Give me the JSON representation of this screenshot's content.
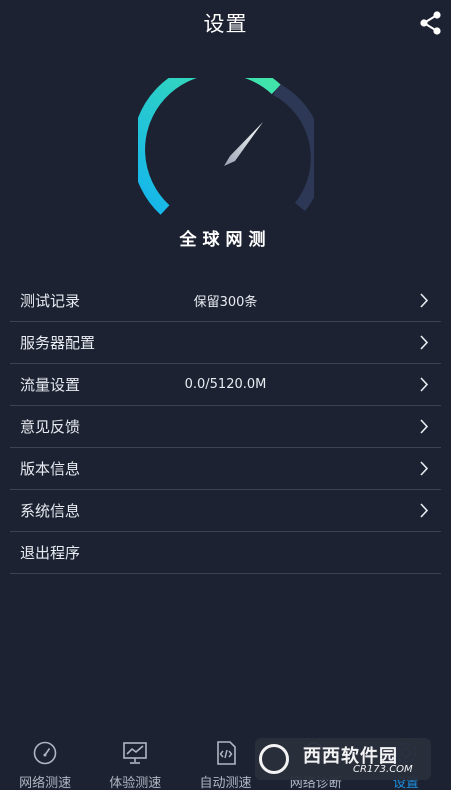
{
  "header": {
    "title": "设置",
    "share_icon": "share-icon"
  },
  "gauge": {
    "brand_text": "全球网测",
    "accent_start": "#1ec3f0",
    "accent_end": "#3fe6a6",
    "track_color": "#2a3550"
  },
  "menu": {
    "items": [
      {
        "label": "测试记录",
        "value": "保留300条",
        "has_chevron": true
      },
      {
        "label": "服务器配置",
        "value": "",
        "has_chevron": true
      },
      {
        "label": "流量设置",
        "value": "0.0/5120.0M",
        "has_chevron": true
      },
      {
        "label": "意见反馈",
        "value": "",
        "has_chevron": true
      },
      {
        "label": "版本信息",
        "value": "",
        "has_chevron": true
      },
      {
        "label": "系统信息",
        "value": "",
        "has_chevron": true
      },
      {
        "label": "退出程序",
        "value": "",
        "has_chevron": false
      }
    ]
  },
  "bottom_nav": {
    "items": [
      {
        "label": "网络测速",
        "icon": "speedometer-icon",
        "active": false
      },
      {
        "label": "体验测速",
        "icon": "monitor-chart-icon",
        "active": false
      },
      {
        "label": "自动测速",
        "icon": "code-file-icon",
        "active": false
      },
      {
        "label": "网络诊断",
        "icon": "diagnose-icon",
        "active": false
      },
      {
        "label": "设置",
        "icon": "settings-icon",
        "active": true
      }
    ],
    "active_color": "#1e90e0"
  },
  "watermark": {
    "text": "西西软件园",
    "sub": "CR173.COM"
  }
}
